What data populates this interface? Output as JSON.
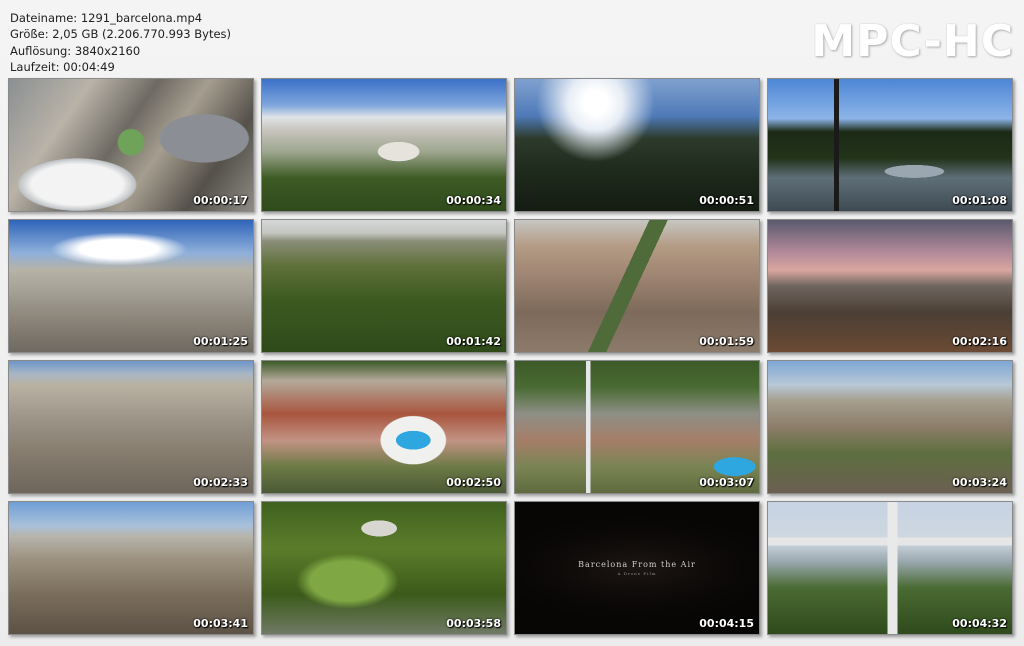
{
  "file_info": {
    "filename_line": "Dateiname: 1291_barcelona.mp4",
    "size_line": "Größe: 2,05 GB (2.206.770.993 Bytes)",
    "resolution_line": "Auflösung: 3840x2160",
    "duration_line": "Laufzeit: 00:04:49"
  },
  "logo": "MPC-HC",
  "thumbnails": [
    {
      "timestamp": "00:00:17",
      "scene": "plaza-bullring-aerial"
    },
    {
      "timestamp": "00:00:34",
      "scene": "palace-city-view"
    },
    {
      "timestamp": "00:00:51",
      "scene": "sun-hillside"
    },
    {
      "timestamp": "00:01:08",
      "scene": "lamp-post-plaza"
    },
    {
      "timestamp": "00:01:25",
      "scene": "city-grid-clouds"
    },
    {
      "timestamp": "00:01:42",
      "scene": "park-forest"
    },
    {
      "timestamp": "00:01:59",
      "scene": "city-blocks"
    },
    {
      "timestamp": "00:02:16",
      "scene": "sunset-rooftops"
    },
    {
      "timestamp": "00:02:33",
      "scene": "eixample-aerial"
    },
    {
      "timestamp": "00:02:50",
      "scene": "olympic-pool"
    },
    {
      "timestamp": "00:03:07",
      "scene": "montjuic-tower"
    },
    {
      "timestamp": "00:03:24",
      "scene": "plaza-espanya"
    },
    {
      "timestamp": "00:03:41",
      "scene": "skyline-avenue"
    },
    {
      "timestamp": "00:03:58",
      "scene": "green-park-path"
    },
    {
      "timestamp": "00:04:15",
      "scene": "dark-credit-frame",
      "credit_text": "Barcelona From the Air",
      "credit_subtext": "A Drone Film"
    },
    {
      "timestamp": "00:04:32",
      "scene": "christ-statue"
    }
  ]
}
